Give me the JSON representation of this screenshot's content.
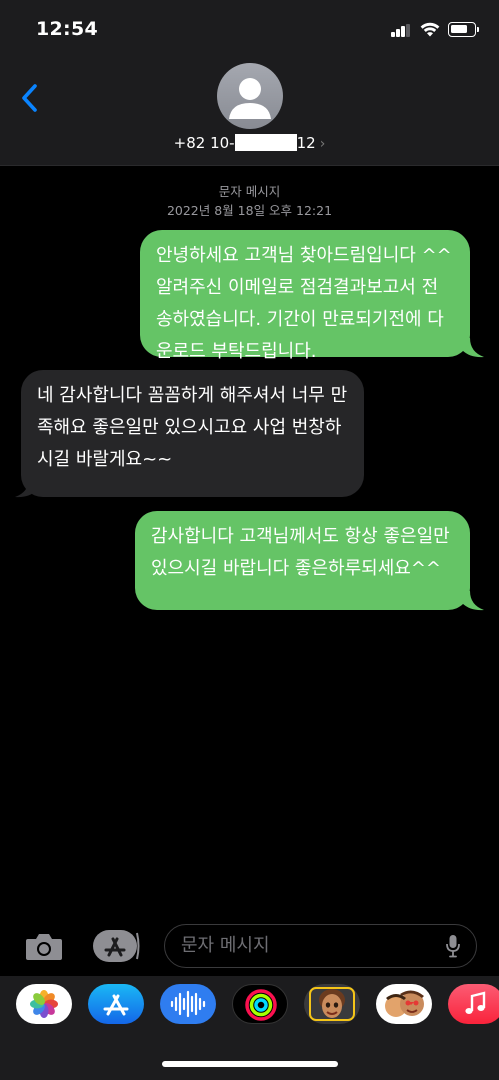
{
  "status_bar": {
    "time": "12:54"
  },
  "header": {
    "contact_prefix": "+82 10-",
    "contact_suffix": "12",
    "chevron": "›"
  },
  "thread_meta": {
    "service": "문자 메시지",
    "timestamp": "2022년 8월 18일 오후 12:21"
  },
  "messages": [
    {
      "direction": "sent",
      "text": "안녕하세요 고객님 찾아드림입니다 ^^ 알려주신 이메일로 점검결과보고서 전송하였습니다. 기간이 만료되기전에 다운로드 부탁드립니다."
    },
    {
      "direction": "received",
      "text": "네 감사합니다 꼼꼼하게 해주셔서 너무 만족해요 좋은일만 있으시고요 사업 번창하시길 바랄게요~~"
    },
    {
      "direction": "sent",
      "text": "감사합니다 고객님께서도 항상 좋은일만 있으시길 바랍니다 좋은하루되세요^^"
    }
  ],
  "input": {
    "placeholder": "문자 메시지"
  },
  "app_drawer": {
    "apps": [
      "photos-icon",
      "app-store-icon",
      "audio-message-icon",
      "activity-icon",
      "memoji-icon",
      "memoji-stickers-icon",
      "music-icon"
    ]
  },
  "colors": {
    "sent_bubble": "#65c466",
    "received_bubble": "#262628",
    "accent_blue": "#0a84ff"
  }
}
